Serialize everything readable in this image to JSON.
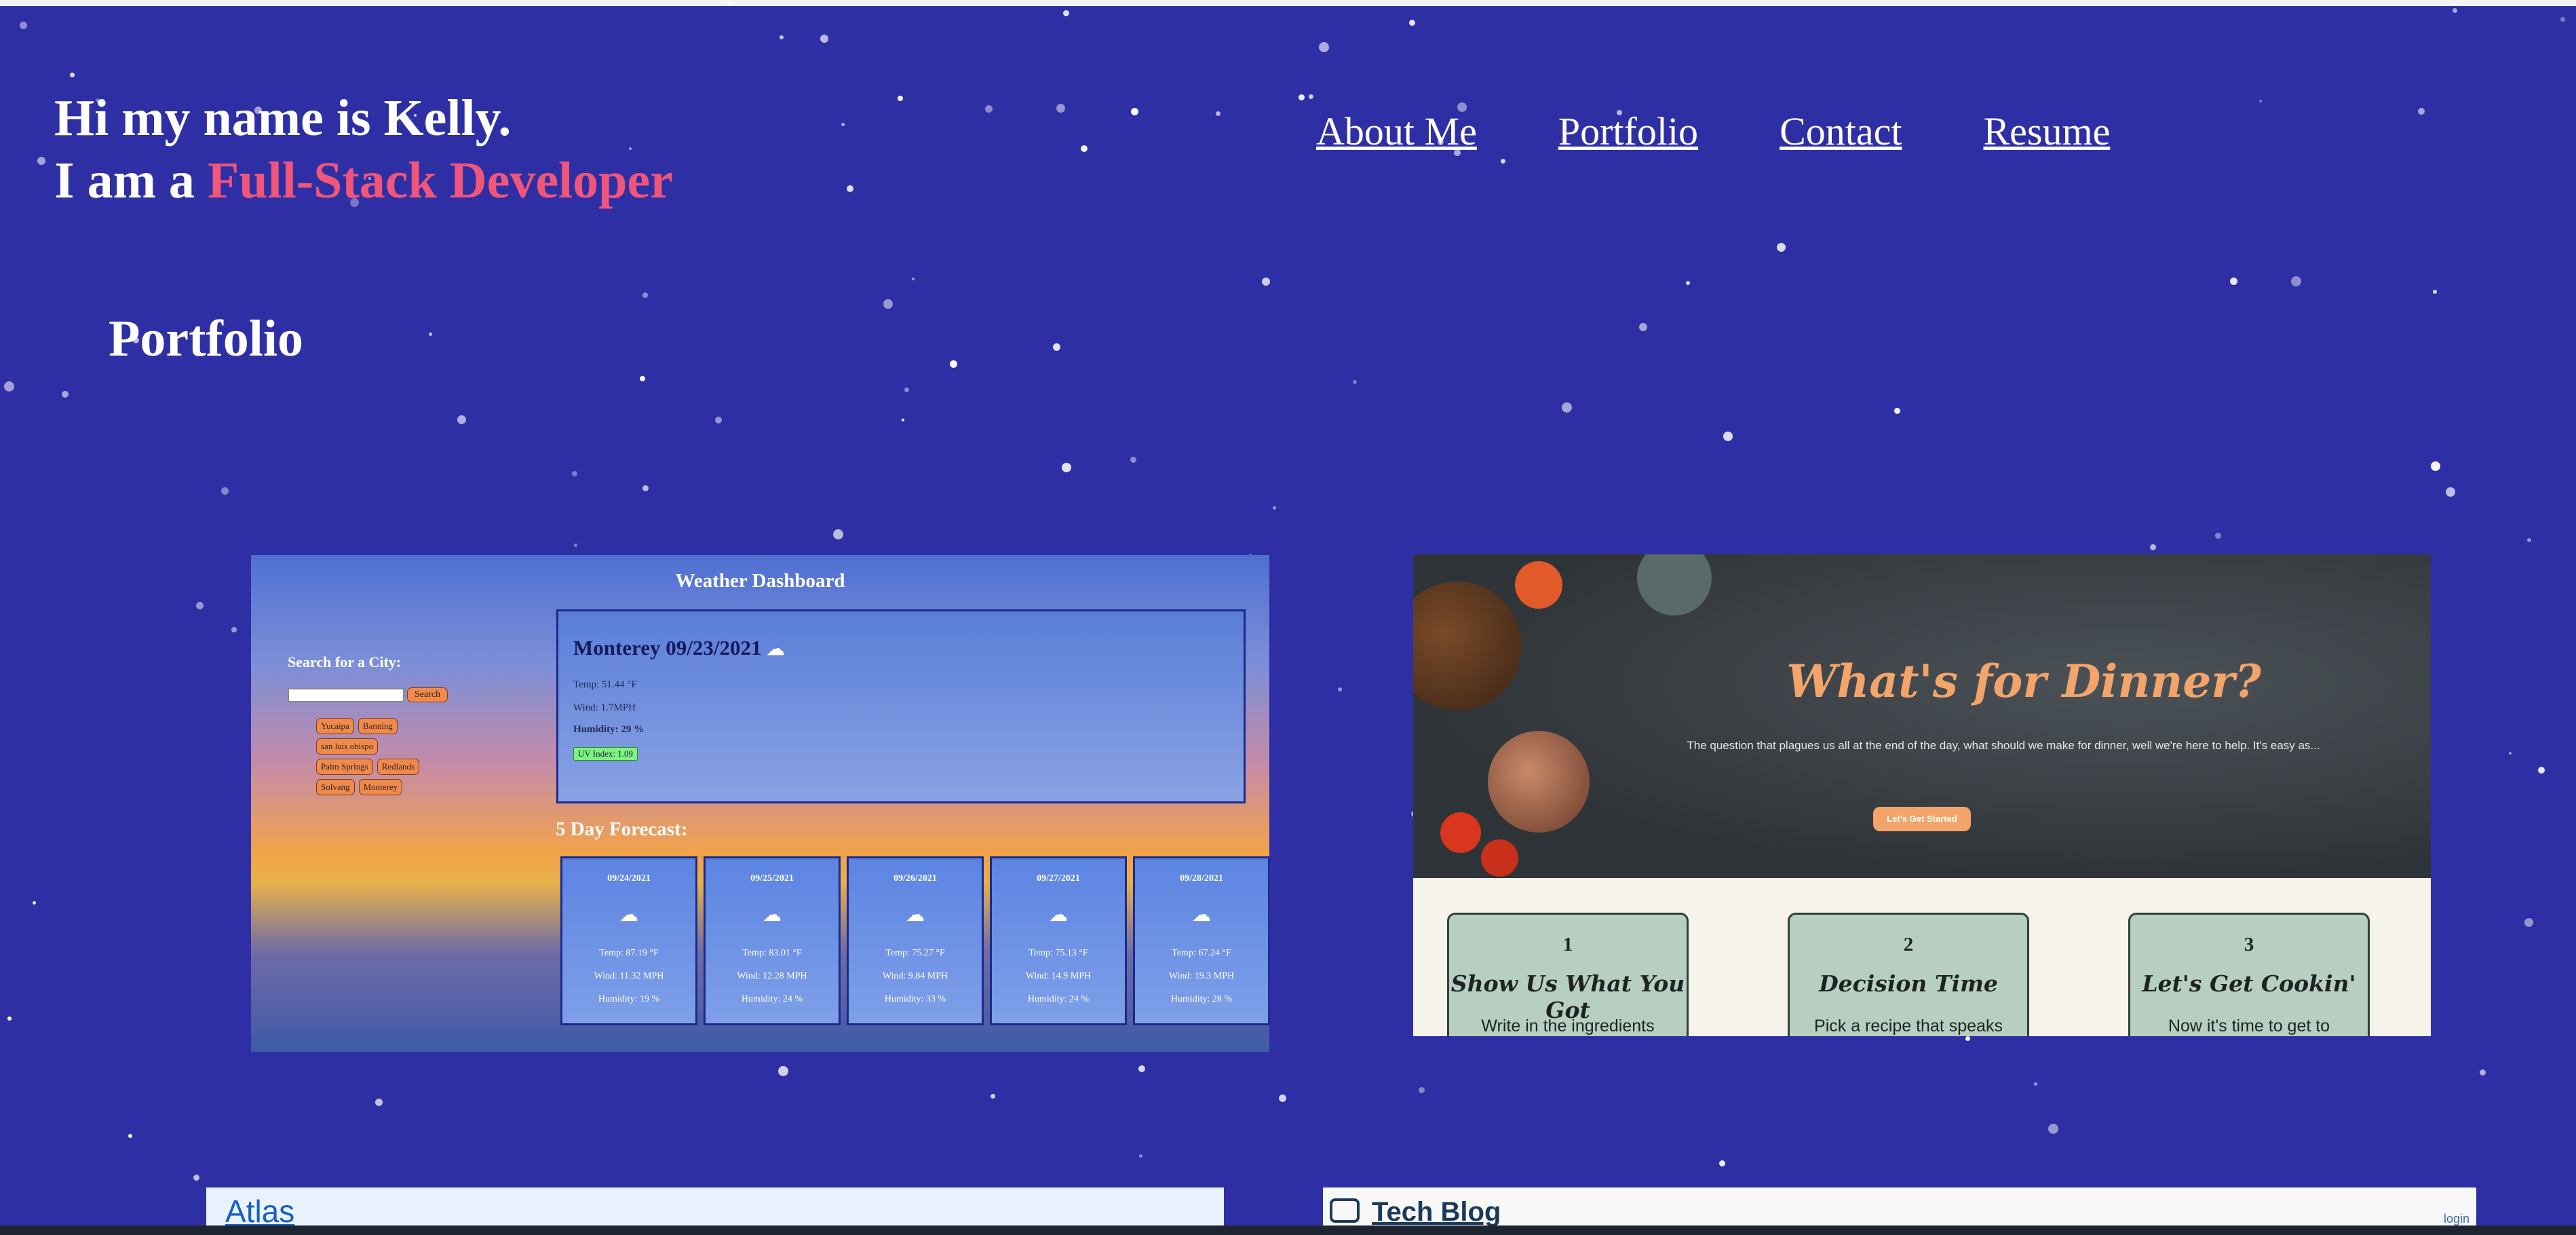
{
  "header": {
    "greeting": "Hi my name is Kelly.",
    "tagline_prefix": "I am a ",
    "tagline_role": "Full-Stack Developer"
  },
  "nav": {
    "items": [
      "About Me",
      "Portfolio",
      "Contact",
      "Resume"
    ]
  },
  "section": {
    "title": "Portfolio"
  },
  "projects": {
    "weather": {
      "title": "Weather Dashboard",
      "search_label": "Search for a City:",
      "search_button": "Search",
      "cities": [
        "Yucaipa",
        "Banning",
        "san luis obispo",
        "Palm Springs",
        "Redlands",
        "Solvang",
        "Monterey"
      ],
      "current": {
        "heading": "Monterey 09/23/2021",
        "temp": "Temp: 51.44 °F",
        "wind": "Wind: 1.7MPH",
        "humidity": "Humidity: 29 %",
        "uv": "UV Index: 1.09"
      },
      "forecast_title": "5 Day Forecast:",
      "forecast": [
        {
          "date": "09/24/2021",
          "temp": "Temp: 87.19 °F",
          "wind": "Wind: 11.32 MPH",
          "humidity": "Humidity: 19 %"
        },
        {
          "date": "09/25/2021",
          "temp": "Temp: 83.01 °F",
          "wind": "Wind: 12.28 MPH",
          "humidity": "Humidity: 24 %"
        },
        {
          "date": "09/26/2021",
          "temp": "Temp: 75.27 °F",
          "wind": "Wind: 9.84 MPH",
          "humidity": "Humidity: 33 %"
        },
        {
          "date": "09/27/2021",
          "temp": "Temp: 75.13 °F",
          "wind": "Wind: 14.9 MPH",
          "humidity": "Humidity: 24 %"
        },
        {
          "date": "09/28/2021",
          "temp": "Temp: 67.24 °F",
          "wind": "Wind: 19.3 MPH",
          "humidity": "Humidity: 28 %"
        }
      ]
    },
    "dinner": {
      "title": "What's for Dinner?",
      "subtitle": "The question that plagues us all at the end of the day, what should we make for dinner, well we're here to help. It's easy as...",
      "cta": "Let's Get Started",
      "steps": [
        {
          "num": "1",
          "title": "Show Us What You Got",
          "desc": "Write in the ingredients"
        },
        {
          "num": "2",
          "title": "Decision Time",
          "desc": "Pick a recipe that speaks"
        },
        {
          "num": "3",
          "title": "Let's Get Cookin'",
          "desc": "Now it's time to get to"
        }
      ]
    },
    "atlas": {
      "title": "Atlas"
    },
    "techblog": {
      "title": "Tech Blog",
      "login": "login"
    }
  },
  "colors": {
    "background": "#2f2fa5",
    "accent": "#f0567a",
    "dinner_accent": "#f2a46a"
  }
}
